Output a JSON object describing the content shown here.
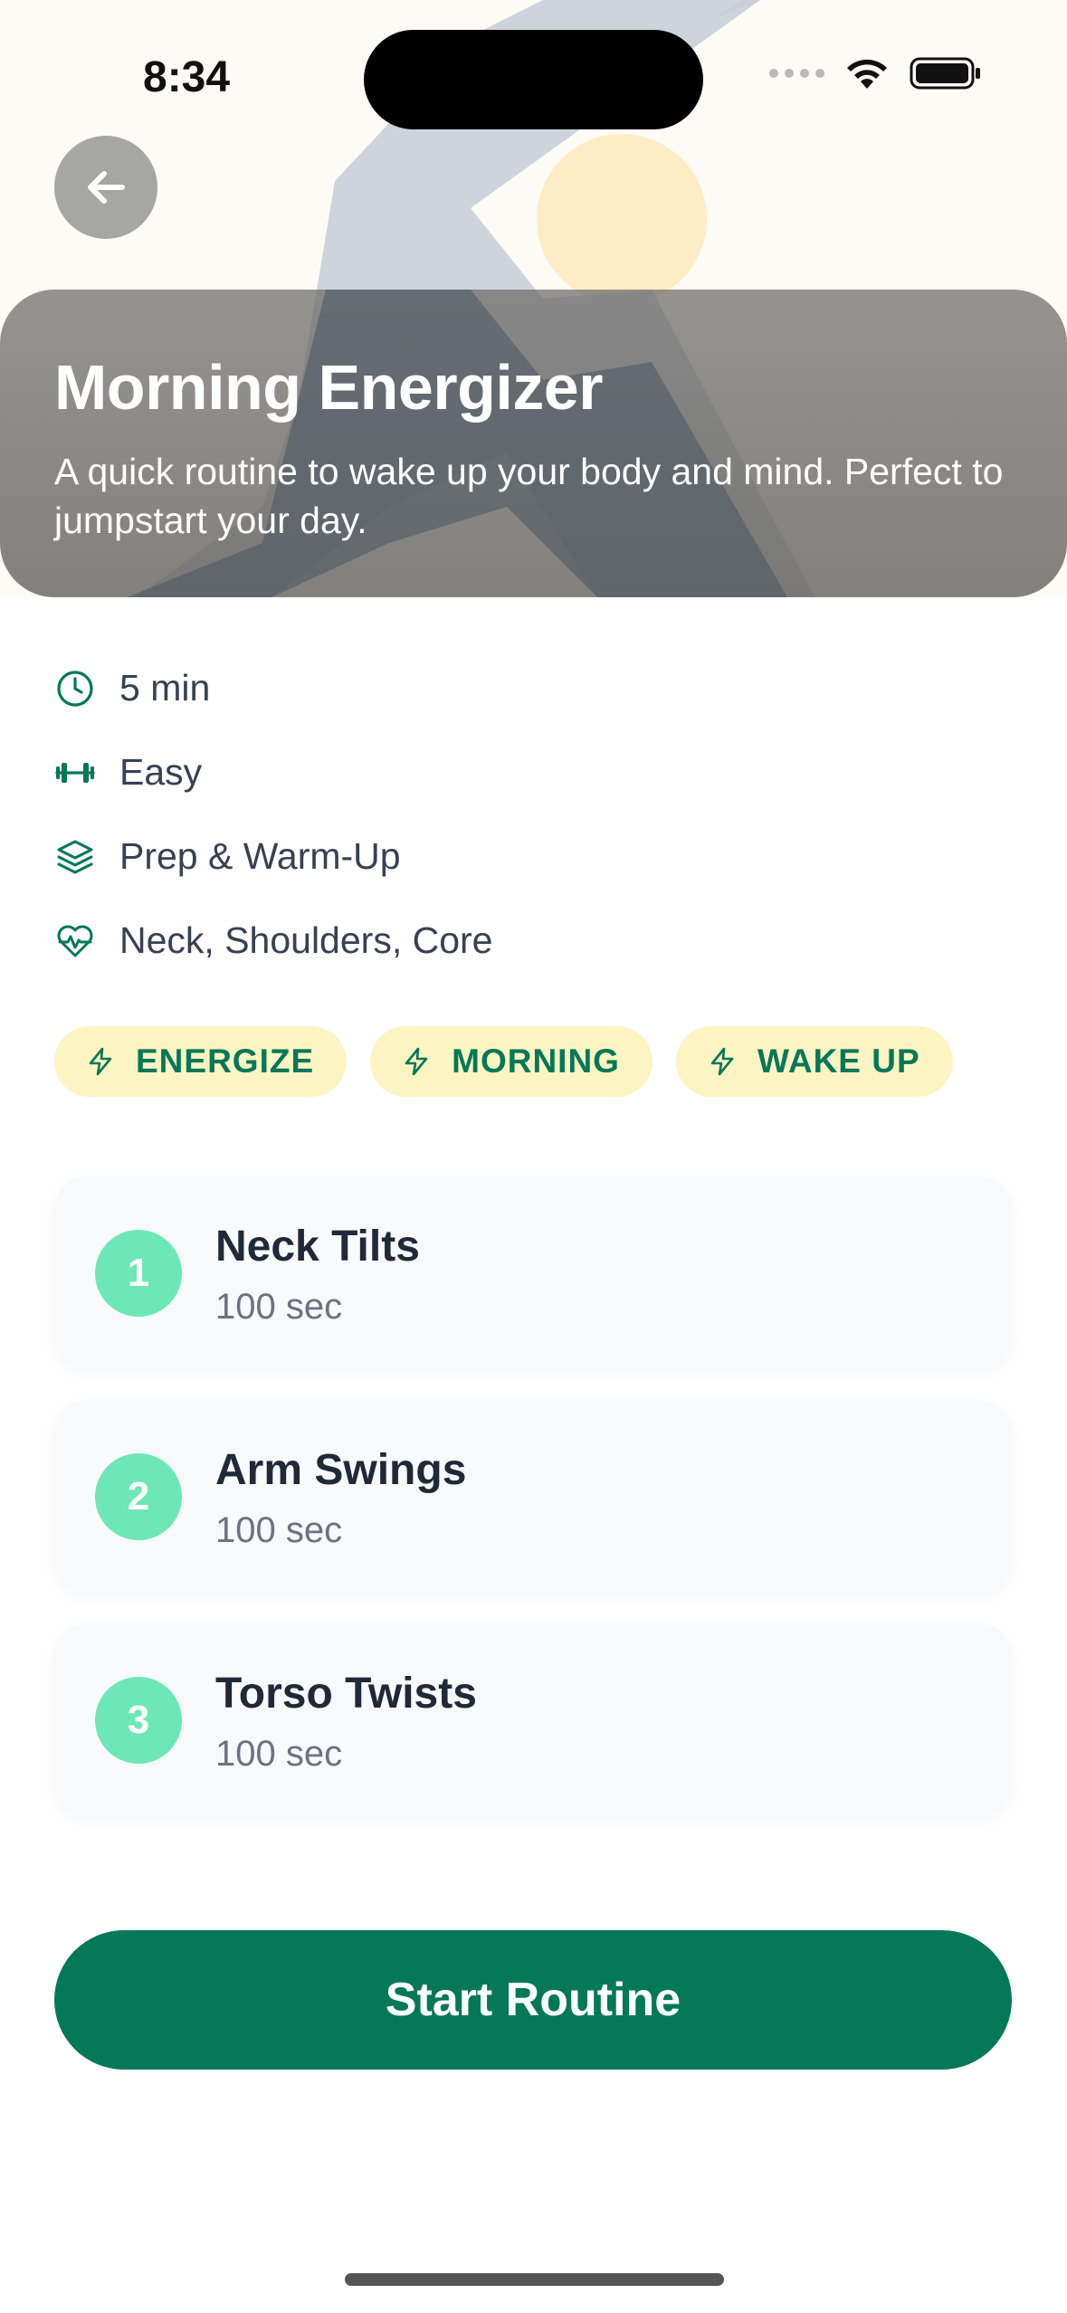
{
  "status_bar": {
    "time": "8:34"
  },
  "routine": {
    "title": "Morning Energizer",
    "description": "A quick routine to wake up your body and mind. Perfect to jumpstart your day."
  },
  "meta": [
    {
      "icon": "clock-icon",
      "text": "5 min"
    },
    {
      "icon": "dumbbell-icon",
      "text": "Easy"
    },
    {
      "icon": "layers-icon",
      "text": "Prep & Warm-Up"
    },
    {
      "icon": "heart-pulse-icon",
      "text": "Neck, Shoulders, Core"
    }
  ],
  "tags": [
    {
      "icon": "lightning-icon",
      "label": "ENERGIZE"
    },
    {
      "icon": "lightning-icon",
      "label": "MORNING"
    },
    {
      "icon": "lightning-icon",
      "label": "WAKE UP"
    }
  ],
  "exercises": [
    {
      "number": "1",
      "name": "Neck Tilts",
      "duration": "100 sec"
    },
    {
      "number": "2",
      "name": "Arm Swings",
      "duration": "100 sec"
    },
    {
      "number": "3",
      "name": "Torso Twists",
      "duration": "100 sec"
    }
  ],
  "start_button": {
    "label": "Start Routine"
  },
  "colors": {
    "accent": "#047857",
    "tag_bg": "#fdf4c4",
    "number_badge": "#6ee7b7",
    "card_bg": "#f8f9fb"
  }
}
